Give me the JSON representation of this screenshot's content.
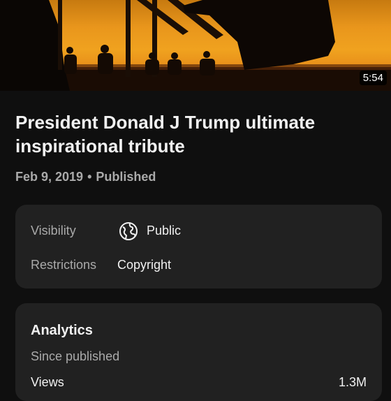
{
  "video": {
    "duration": "5:54",
    "title": "President Donald J Trump ultimate inspirational tribute",
    "date": "Feb 9, 2019",
    "separator": "•",
    "status": "Published"
  },
  "details": {
    "visibility_label": "Visibility",
    "visibility_value": "Public",
    "visibility_icon": "globe-icon",
    "restrictions_label": "Restrictions",
    "restrictions_value": "Copyright"
  },
  "analytics": {
    "title": "Analytics",
    "subtitle": "Since published",
    "views_label": "Views",
    "views_value": "1.3M"
  },
  "colors": {
    "background": "#0f0f0f",
    "card": "#212121",
    "secondary_text": "#aaaaaa",
    "primary_text": "#f1f1f1"
  }
}
